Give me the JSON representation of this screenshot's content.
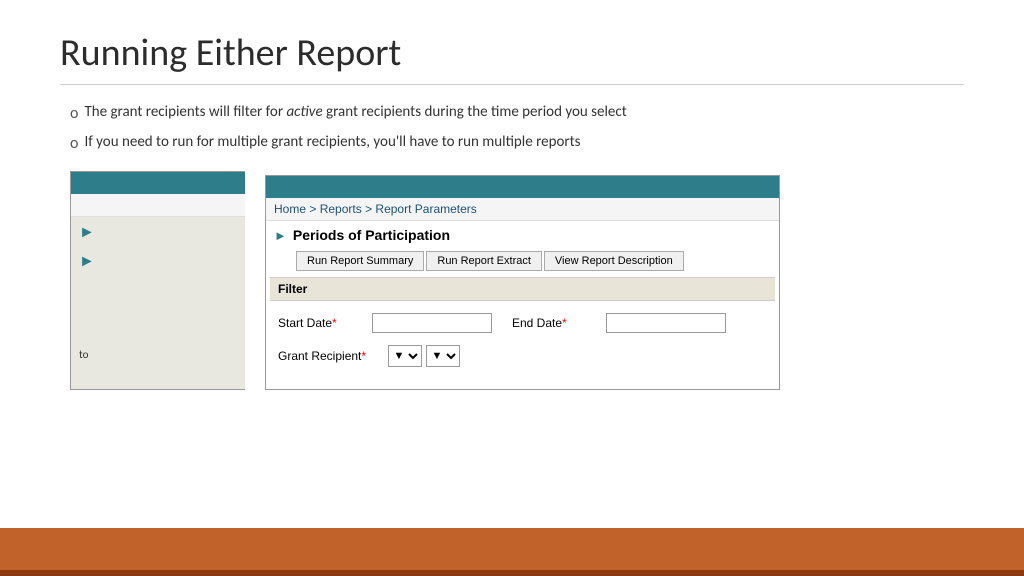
{
  "slide": {
    "title": "Running Either Report",
    "bullets": [
      {
        "id": "bullet1",
        "prefix": "The grant recipients will filter for ",
        "italic": "active",
        "suffix": " grant recipients during the time period you select"
      },
      {
        "id": "bullet2",
        "text": "If you need to run for multiple grant recipients, you'll have to run multiple reports"
      }
    ]
  },
  "screenshot": {
    "header_bar_text": "...",
    "breadcrumb": {
      "home": "Home",
      "separator1": " > ",
      "reports": "Reports",
      "separator2": " > ",
      "current": "Report Parameters"
    },
    "section_title": "Periods of Participation",
    "buttons": {
      "run_summary": "Run Report Summary",
      "run_extract": "Run Report Extract",
      "view_description": "View Report Description"
    },
    "filter_label": "Filter",
    "form": {
      "start_date_label": "Start Date",
      "end_date_label": "End Date",
      "grant_recipient_label": "Grant Recipient",
      "required_marker": "*"
    }
  }
}
